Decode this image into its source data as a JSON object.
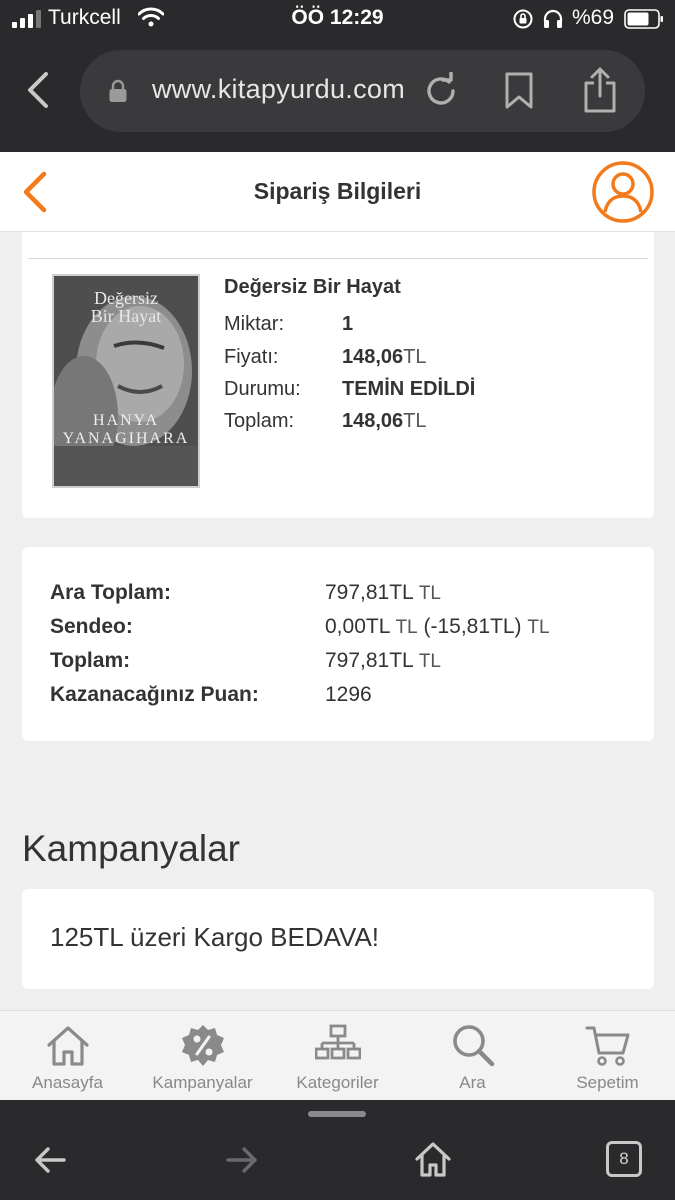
{
  "status_bar": {
    "carrier": "Turkcell",
    "time": "ÖÖ 12:29",
    "battery": "%69"
  },
  "browser": {
    "url": "www.kitapyurdu.com",
    "tab_count": "8"
  },
  "header": {
    "title": "Sipariş Bilgileri"
  },
  "product": {
    "title": "Değersiz Bir Hayat",
    "cover": {
      "title_line1": "Değersiz",
      "title_line2": "Bir Hayat",
      "author_line1": "HANYA",
      "author_line2": "YANAGIHARA"
    },
    "rows": [
      {
        "label": "Miktar:",
        "value": "1",
        "currency": ""
      },
      {
        "label": "Fiyatı:",
        "value": "148,06",
        "currency": "TL"
      },
      {
        "label": "Durumu:",
        "value": "TEMİN EDİLDİ",
        "currency": ""
      },
      {
        "label": "Toplam:",
        "value": "148,06",
        "currency": "TL"
      }
    ]
  },
  "summary": {
    "rows": [
      {
        "label": "Ara Toplam:",
        "value": "797,81TL",
        "suffix": "TL"
      },
      {
        "label": "Sendeo:",
        "value": "0,00TL",
        "suffix": "TL",
        "extra": "(-15,81TL)",
        "extra_suffix": "TL"
      },
      {
        "label": "Toplam:",
        "value": "797,81TL",
        "suffix": "TL"
      },
      {
        "label": "Kazanacağınız Puan:",
        "value": "1296",
        "suffix": ""
      }
    ]
  },
  "campaigns": {
    "title": "Kampanyalar",
    "items": [
      "125TL üzeri Kargo BEDAVA!"
    ]
  },
  "tabbar": {
    "items": [
      {
        "label": "Anasayfa",
        "icon": "home-icon"
      },
      {
        "label": "Kampanyalar",
        "icon": "percent-badge-icon"
      },
      {
        "label": "Kategoriler",
        "icon": "sitemap-icon"
      },
      {
        "label": "Ara",
        "icon": "search-icon"
      },
      {
        "label": "Sepetim",
        "icon": "cart-icon"
      }
    ]
  },
  "colors": {
    "accent": "#f27a1a",
    "page_bg": "#efeff0",
    "browser_chrome": "#2a2a2c"
  }
}
